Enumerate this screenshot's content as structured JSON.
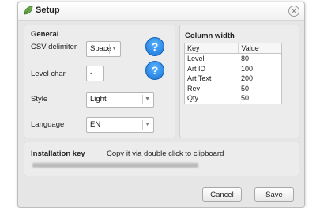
{
  "window": {
    "title": "Setup"
  },
  "general": {
    "heading": "General",
    "csv_delimiter_label": "CSV delimiter",
    "csv_delimiter_value": "Space",
    "level_char_label": "Level char",
    "level_char_value": "-",
    "style_label": "Style",
    "style_value": "Light",
    "language_label": "Language",
    "language_value": "EN",
    "help_symbol": "?"
  },
  "column_width": {
    "heading": "Column width",
    "headers": [
      "Key",
      "Value"
    ],
    "rows": [
      [
        "Level",
        "80"
      ],
      [
        "Art ID",
        "100"
      ],
      [
        "Art Text",
        "200"
      ],
      [
        "Rev",
        "50"
      ],
      [
        "Qty",
        "50"
      ]
    ]
  },
  "installation": {
    "heading": "Installation key",
    "hint": "Copy it via double click to clipboard"
  },
  "buttons": {
    "cancel": "Cancel",
    "save": "Save"
  },
  "icons": {
    "app": "leaf-icon",
    "close": "close-icon",
    "help": "help-icon",
    "dropdown": "chevron-down-icon"
  },
  "colors": {
    "accent": "#1a73d6",
    "leaf": "#6aa84f"
  }
}
